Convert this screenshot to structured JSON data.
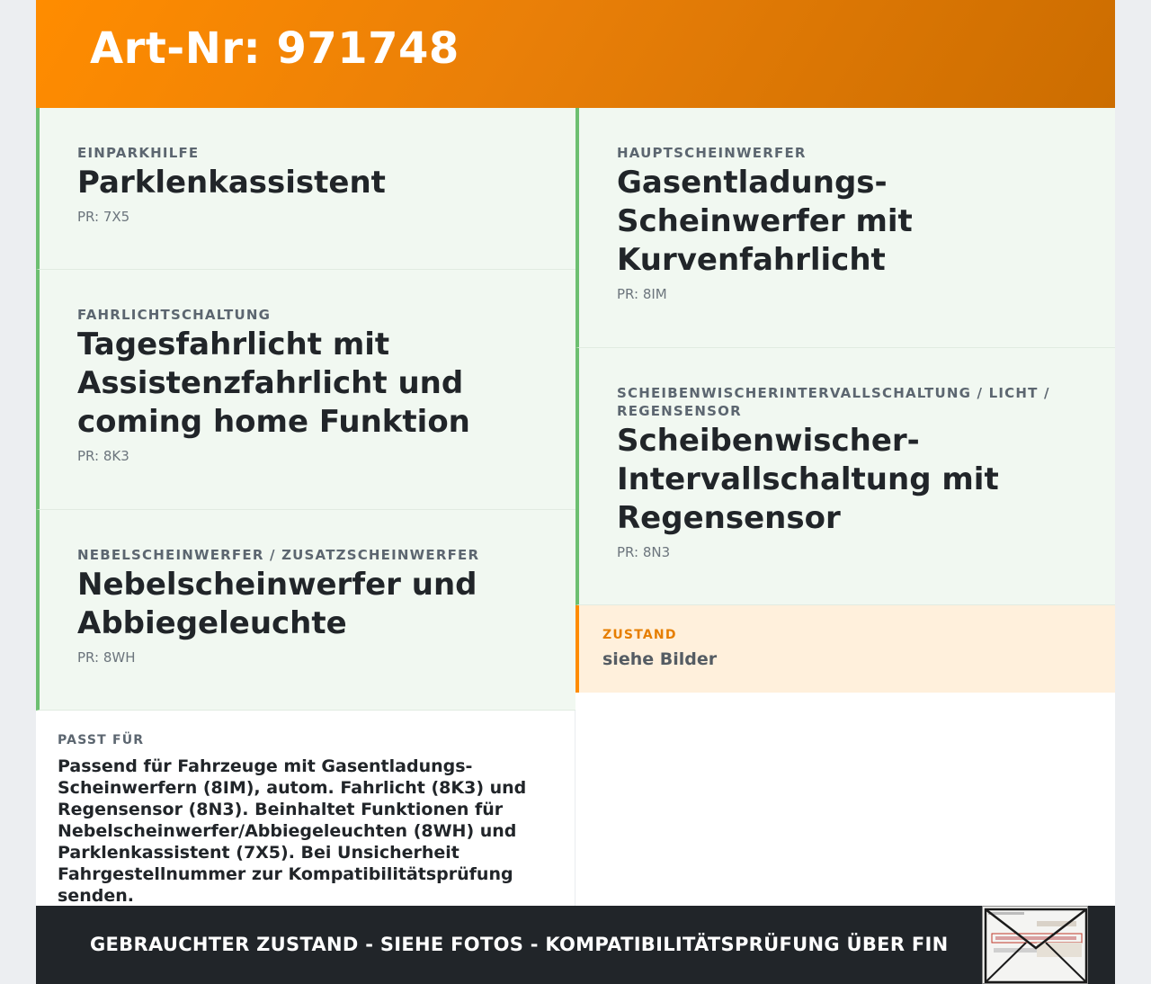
{
  "header": {
    "title": "Art-Nr: 971748"
  },
  "left_cards": [
    {
      "category": "EINPARKHILFE",
      "title": "Parklenkassistent",
      "pr": "PR: 7X5"
    },
    {
      "category": "FAHRLICHTSCHALTUNG",
      "title": "Tagesfahrlicht mit Assistenzfahrlicht und coming home Funktion",
      "pr": "PR: 8K3"
    },
    {
      "category": "NEBELSCHEINWERFER / ZUSATZSCHEINWERFER",
      "title": "Nebelscheinwerfer und Abbiegeleuchte",
      "pr": "PR: 8WH"
    }
  ],
  "right_cards": [
    {
      "category": "HAUPTSCHEINWERFER",
      "title": "Gasentladungs-Scheinwerfer mit Kurvenfahrlicht",
      "pr": "PR: 8IM"
    },
    {
      "category": "SCHEIBENWISCHERINTERVALLSCHALTUNG / LICHT / REGENSENSOR",
      "title": "Scheibenwischer-Intervallschaltung mit Regensensor",
      "pr": "PR: 8N3"
    }
  ],
  "passt": {
    "label": "PASST FÜR",
    "text": "Passend für Fahrzeuge mit Gasentladungs-Scheinwerfern (8IM), autom. Fahrlicht (8K3) und Regensensor (8N3). Beinhaltet Funktionen für Nebelscheinwerfer/Abbiegeleuchten (8WH) und Parklenkassistent (7X5). Bei Unsicherheit Fahrgestellnummer zur Kompatibilitätsprüfung senden."
  },
  "zustand": {
    "label": "ZUSTAND",
    "value": "siehe Bilder"
  },
  "footer": {
    "text": "GEBRAUCHTER ZUSTAND - SIEHE FOTOS - KOMPATIBILITÄTSPRÜFUNG ÜBER FIN",
    "thumbnail_icon": "envelope-icon"
  },
  "colors": {
    "accent": "#ff8c00",
    "green": "#6dbf71",
    "card_bg": "#f1f8f1",
    "dark": "#212529"
  }
}
